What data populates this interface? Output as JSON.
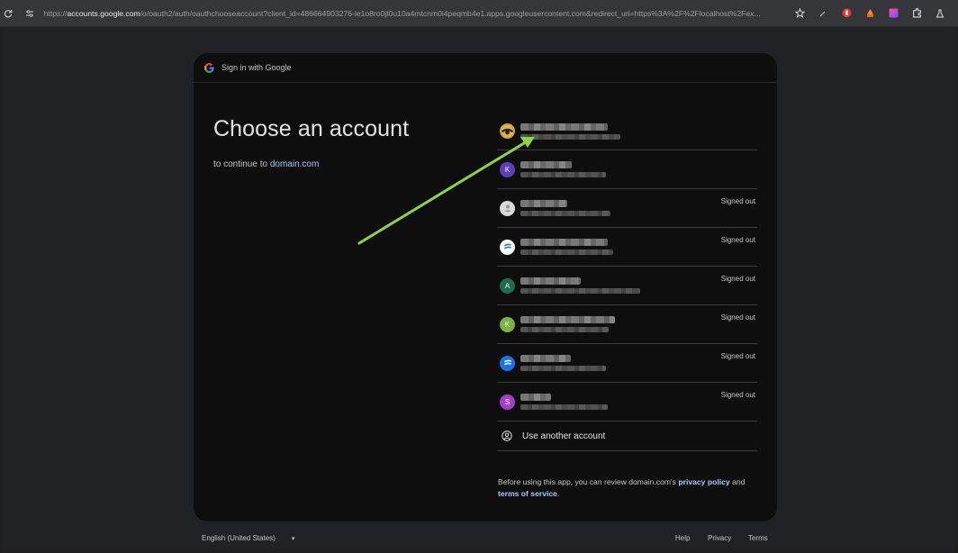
{
  "browser": {
    "url_prefix": "https://",
    "url_host": "accounts.google.com",
    "url_rest": "/o/oauth2/auth/oauthchooseaccount?client_id=486664903276-ie1o8ro0jt0u10a4mtcnm0i4peqmb4e1.apps.googleusercontent.com&redirect_uri=https%3A%2F%2Flocalhost%2Fex..."
  },
  "header": {
    "title": "Sign in with Google"
  },
  "main": {
    "title": "Choose an account",
    "continue_prefix": "to continue to ",
    "continue_domain": "domain.com"
  },
  "accounts": [
    {
      "avatar_letter": "",
      "avatar_color": "#b8860b",
      "status": ""
    },
    {
      "avatar_letter": "K",
      "avatar_color": "#5b3fb8",
      "status": ""
    },
    {
      "avatar_letter": "",
      "avatar_color": "#d9d9d9",
      "status": "Signed out"
    },
    {
      "avatar_letter": "",
      "avatar_color": "#ffffff",
      "status": "Signed out"
    },
    {
      "avatar_letter": "A",
      "avatar_color": "#1e6b4f",
      "status": "Signed out"
    },
    {
      "avatar_letter": "K",
      "avatar_color": "#7cb342",
      "status": "Signed out"
    },
    {
      "avatar_letter": "",
      "avatar_color": "#1a73e8",
      "status": "Signed out"
    },
    {
      "avatar_letter": "S",
      "avatar_color": "#a142c6",
      "status": "Signed out"
    }
  ],
  "use_another": {
    "label": "Use another account"
  },
  "disclaimer": {
    "text_before": "Before using this app, you can review domain.com's ",
    "privacy_link": "privacy policy",
    "text_and": " and",
    "terms_link": "terms of service",
    "text_end": "."
  },
  "footer": {
    "language": "English (United States)",
    "help": "Help",
    "privacy": "Privacy",
    "terms": "Terms"
  },
  "colors": {
    "accent_link": "#a8c7fa",
    "annotation_arrow": "#8bd44a"
  },
  "icons": [
    "reload-icon",
    "site-settings-icon",
    "bookmark-star-icon",
    "extension-icon",
    "google-logo-icon",
    "account-circle-icon"
  ]
}
